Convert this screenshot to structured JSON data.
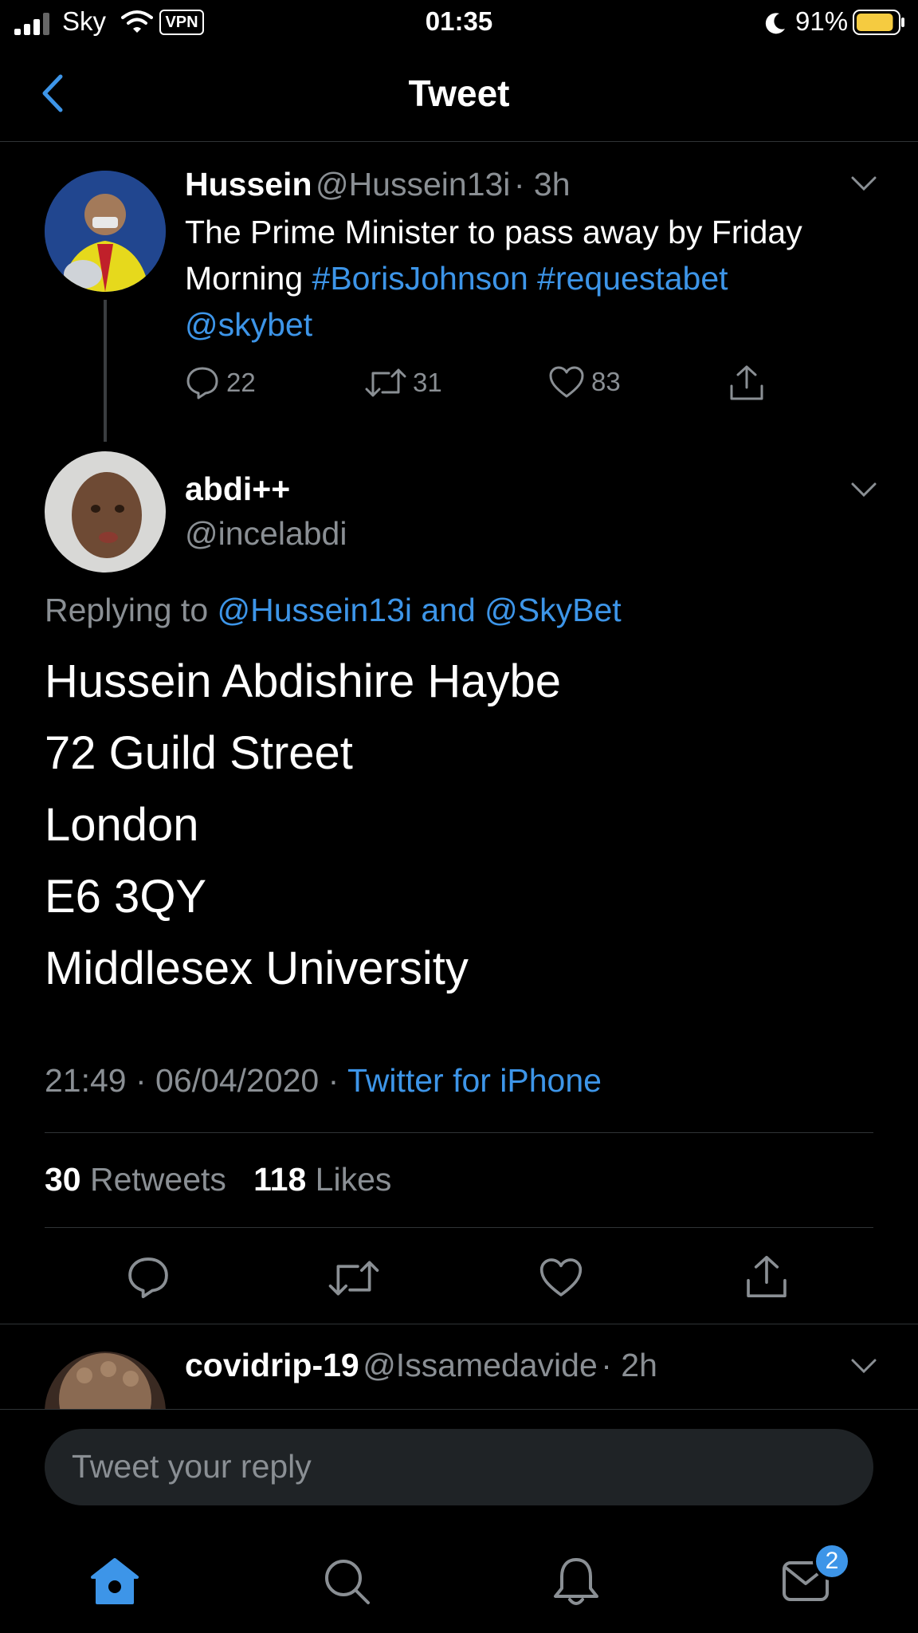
{
  "status_bar": {
    "carrier": "Sky",
    "vpn": "VPN",
    "time": "01:35",
    "battery": "91%",
    "battery_level": 0.91
  },
  "nav": {
    "title": "Tweet",
    "back_icon": "chevron-left-icon"
  },
  "parent_tweet": {
    "name": "Hussein",
    "handle": "@Hussein13i",
    "time": "· 3h",
    "text_plain1": "The Prime Minister to pass away by Friday",
    "text_plain2": "Morning ",
    "hashtag1": "#BorisJohnson",
    "hashtag2": "#requestabet",
    "mention": "@skybet",
    "replies": "22",
    "retweets": "31",
    "likes": "83"
  },
  "main_tweet": {
    "name": "abdi++",
    "handle": "@incelabdi",
    "replying_prefix": "Replying to ",
    "replying_to": "@Hussein13i and @SkyBet",
    "lines": [
      "Hussein Abdishire Haybe",
      "72 Guild Street",
      "London",
      "E6 3QY",
      "Middlesex University"
    ],
    "timestamp": "21:49 · 06/04/2020 · ",
    "source": "Twitter for iPhone",
    "retweet_count": "30",
    "retweet_label": " Retweets",
    "like_count": "118",
    "like_label": " Likes"
  },
  "next_tweet": {
    "name": "covidrip-19",
    "handle": "@Issamedavide",
    "time": "· 2h"
  },
  "reply": {
    "placeholder": "Tweet your reply"
  },
  "tabbar": {
    "messages_badge": "2"
  },
  "colors": {
    "accent": "#3d95e8",
    "background": "#000000",
    "secondary_text": "#8a8f94",
    "battery": "#f5cb40"
  }
}
